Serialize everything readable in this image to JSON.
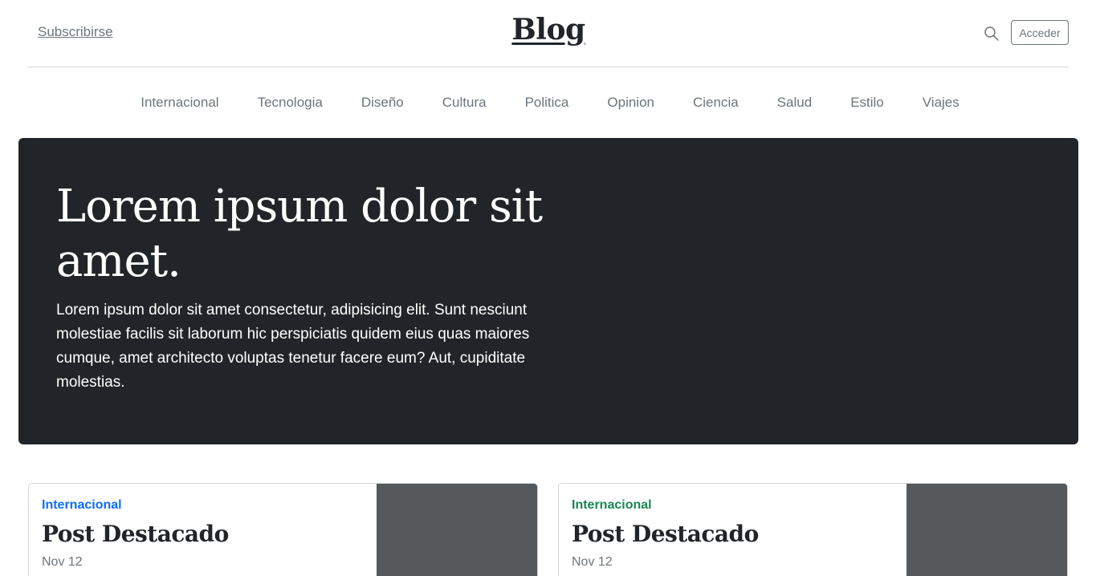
{
  "header": {
    "subscribe_label": "Subscribirse",
    "brand": "Blog",
    "search_icon": "search-icon",
    "login_label": "Acceder"
  },
  "nav": {
    "items": [
      "Internacional",
      "Tecnologia",
      "Diseño",
      "Cultura",
      "Politica",
      "Opinion",
      "Ciencia",
      "Salud",
      "Estilo",
      "Viajes"
    ]
  },
  "hero": {
    "title": "Lorem ipsum dolor sit amet.",
    "lead": "Lorem ipsum dolor sit amet consectetur, adipisicing elit. Sunt nesciunt molestiae facilis sit laborum hic perspiciatis quidem eius quas maiores cumque, amet architecto voluptas tenetur facere eum? Aut, cupiditate molestias."
  },
  "cards": [
    {
      "category": "Internacional",
      "category_color": "#0d6efd",
      "title": "Post Destacado",
      "date": "Nov 12"
    },
    {
      "category": "Internacional",
      "category_color": "#198754",
      "title": "Post Destacado",
      "date": "Nov 12"
    }
  ],
  "colors": {
    "hero_bg": "#212529",
    "thumb_bg": "#55595c",
    "muted": "#6c757d"
  }
}
